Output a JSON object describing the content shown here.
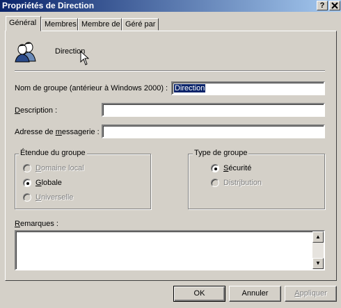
{
  "window": {
    "title": "Propriétés de Direction",
    "help_btn": "?",
    "close_btn": "X"
  },
  "tabs": [
    {
      "label": "Général",
      "active": true
    },
    {
      "label": "Membres"
    },
    {
      "label": "Membre de"
    },
    {
      "label": "Géré par"
    }
  ],
  "group": {
    "name": "Direction",
    "icon": "users-group-icon"
  },
  "fields": {
    "prewin2000_label": "Nom de groupe (antérieur à Windows 2000) :",
    "prewin2000_value": "Direction",
    "description_label": "Description :",
    "description_value": "",
    "email_label": "Adresse de messagerie :",
    "email_value": ""
  },
  "scope": {
    "title": "Étendue du groupe",
    "options": [
      "Domaine local",
      "Globale",
      "Universelle"
    ],
    "selected": "Globale"
  },
  "type": {
    "title": "Type de groupe",
    "options": [
      "Sécurité",
      "Distribution"
    ],
    "selected": "Sécurité"
  },
  "notes": {
    "label": "Remarques :",
    "value": ""
  },
  "buttons": {
    "ok": "OK",
    "cancel": "Annuler",
    "apply": "Appliquer"
  }
}
